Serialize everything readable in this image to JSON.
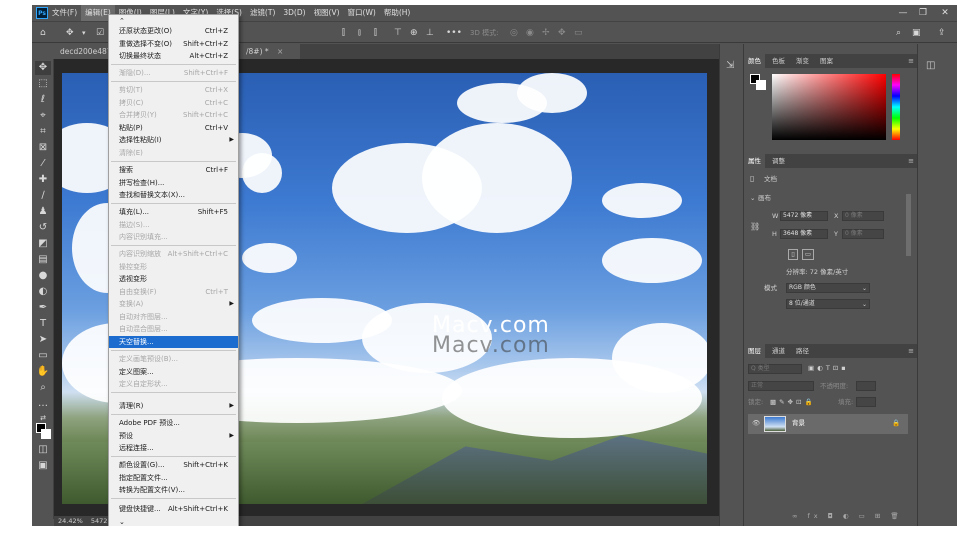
{
  "menubar": {
    "logo": "Ps",
    "items": [
      "文件(F)",
      "编辑(E)",
      "图像(I)",
      "图层(L)",
      "文字(Y)",
      "选择(S)",
      "滤镜(T)",
      "3D(D)",
      "视图(V)",
      "窗口(W)",
      "帮助(H)"
    ],
    "window_controls": [
      "—",
      "❐",
      "✕"
    ]
  },
  "optionsbar": {
    "mode_3d_label": "3D 模式:"
  },
  "tabs": {
    "doc_tab_label": "decd200e487e",
    "doc_tab2_label": "/8#) *",
    "close_glyph": "×"
  },
  "edit_menu": {
    "items": [
      {
        "label": "还原状态更改(O)",
        "shortcut": "Ctrl+Z",
        "disabled": false
      },
      {
        "label": "重做选择不变(O)",
        "shortcut": "Shift+Ctrl+Z",
        "disabled": false
      },
      {
        "label": "切换最终状态",
        "shortcut": "Alt+Ctrl+Z",
        "disabled": false
      },
      {
        "label": "渐隐(D)...",
        "shortcut": "Shift+Ctrl+F",
        "disabled": true
      },
      {
        "label": "剪切(T)",
        "shortcut": "Ctrl+X",
        "disabled": true
      },
      {
        "label": "拷贝(C)",
        "shortcut": "Ctrl+C",
        "disabled": true
      },
      {
        "label": "合并拷贝(Y)",
        "shortcut": "Shift+Ctrl+C",
        "disabled": true
      },
      {
        "label": "粘贴(P)",
        "shortcut": "Ctrl+V",
        "disabled": false
      },
      {
        "label": "选择性粘贴(I)",
        "shortcut": "",
        "disabled": false
      },
      {
        "label": "清除(E)",
        "shortcut": "",
        "disabled": true
      },
      {
        "label": "搜索",
        "shortcut": "Ctrl+F",
        "disabled": false
      },
      {
        "label": "拼写检查(H)...",
        "shortcut": "",
        "disabled": false
      },
      {
        "label": "查找和替换文本(X)...",
        "shortcut": "",
        "disabled": false
      },
      {
        "label": "填充(L)...",
        "shortcut": "Shift+F5",
        "disabled": false
      },
      {
        "label": "描边(S)...",
        "shortcut": "",
        "disabled": true
      },
      {
        "label": "内容识别填充...",
        "shortcut": "",
        "disabled": true
      },
      {
        "label": "内容识别缩放",
        "shortcut": "Alt+Shift+Ctrl+C",
        "disabled": true
      },
      {
        "label": "操控变形",
        "shortcut": "",
        "disabled": true
      },
      {
        "label": "透视变形",
        "shortcut": "",
        "disabled": false
      },
      {
        "label": "自由变换(F)",
        "shortcut": "Ctrl+T",
        "disabled": true
      },
      {
        "label": "变换(A)",
        "shortcut": "",
        "disabled": true
      },
      {
        "label": "自动对齐图层...",
        "shortcut": "",
        "disabled": true
      },
      {
        "label": "自动混合图层...",
        "shortcut": "",
        "disabled": true
      },
      {
        "label": "天空替换...",
        "shortcut": "",
        "disabled": false
      },
      {
        "label": "定义画笔预设(B)...",
        "shortcut": "",
        "disabled": true
      },
      {
        "label": "定义图案...",
        "shortcut": "",
        "disabled": false
      },
      {
        "label": "定义自定形状...",
        "shortcut": "",
        "disabled": true
      },
      {
        "label": "清理(R)",
        "shortcut": "",
        "disabled": false
      },
      {
        "label": "Adobe PDF 预设...",
        "shortcut": "",
        "disabled": false
      },
      {
        "label": "预设",
        "shortcut": "",
        "disabled": false
      },
      {
        "label": "远程连接...",
        "shortcut": "",
        "disabled": false
      },
      {
        "label": "颜色设置(G)...",
        "shortcut": "Shift+Ctrl+K",
        "disabled": false
      },
      {
        "label": "指定配置文件...",
        "shortcut": "",
        "disabled": false
      },
      {
        "label": "转换为配置文件(V)...",
        "shortcut": "",
        "disabled": false
      },
      {
        "label": "键盘快捷键...",
        "shortcut": "Alt+Shift+Ctrl+K",
        "disabled": false
      }
    ],
    "top_arrow": "⌃",
    "bottom_arrow": "⌄"
  },
  "canvas": {
    "watermark": "Macv.com"
  },
  "statusbar": {
    "zoom": "24.42%",
    "size": "5472"
  },
  "color_panel": {
    "tabs": [
      "颜色",
      "色板",
      "渐变",
      "图案"
    ]
  },
  "properties_panel": {
    "tabs": [
      "属性",
      "调整"
    ],
    "doc_label": "文档",
    "section": "画布",
    "w_label": "W",
    "w_value": "5472 像素",
    "h_label": "H",
    "h_value": "3648 像素",
    "x_label": "X",
    "x_placeholder": "0 像素",
    "y_label": "Y",
    "y_placeholder": "0 像素",
    "resolution": "分辨率: 72 像素/英寸",
    "mode_label": "模式",
    "mode_value": "RGB 颜色",
    "depth_value": "8 位/通道"
  },
  "layers_panel": {
    "tabs": [
      "图层",
      "通道",
      "路径"
    ],
    "search_placeholder": "Q 类型",
    "blend_mode": "正常",
    "opacity_label": "不透明度:",
    "lock_label": "锁定:",
    "fill_label": "填充:",
    "layer_name": "背景"
  }
}
